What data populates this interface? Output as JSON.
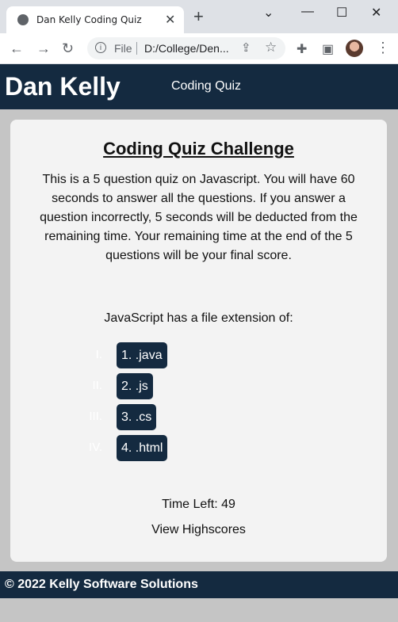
{
  "browser": {
    "tab_title": "Dan Kelly Coding Quiz",
    "new_tab_label": "+",
    "address_scheme": "File",
    "address_url": "D:/College/Den..."
  },
  "header": {
    "brand": "Dan Kelly",
    "nav_link": "Coding Quiz"
  },
  "quiz": {
    "title": "Coding Quiz Challenge",
    "intro": "This is a 5 question quiz on Javascript. You will have 60 seconds to answer all the questions. If you answer a question incorrectly, 5 seconds will be deducted from the remaining time. Your remaining time at the end of the 5 questions will be your final score.",
    "question": "JavaScript has a file extension of:",
    "choices": [
      {
        "numeral": "I.",
        "label": "1. .java"
      },
      {
        "numeral": "II.",
        "label": "2. .js"
      },
      {
        "numeral": "III.",
        "label": "3. .cs"
      },
      {
        "numeral": "IV.",
        "label": "4. .html"
      }
    ],
    "timer_text": "Time Left: 49",
    "highscores_link": "View Highscores"
  },
  "footer": {
    "copyright": "© 2022 Kelly Software Solutions"
  },
  "colors": {
    "primary": "#142a40",
    "card": "#f3f3f3",
    "page_bg": "#c5c5c5"
  }
}
